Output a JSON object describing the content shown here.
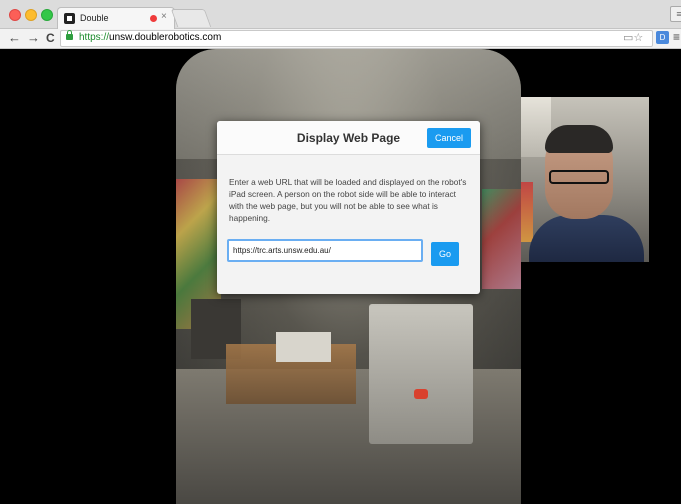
{
  "browser": {
    "tab_title": "Double",
    "tab_close": "×",
    "url_scheme": "https://",
    "url_host": "unsw.doublerobotics.com",
    "nav": {
      "back": "←",
      "forward": "→",
      "reload": "C"
    },
    "omnibox_icons": "▭☆",
    "menu": "≡"
  },
  "dialog": {
    "title": "Display Web Page",
    "cancel_label": "Cancel",
    "description": "Enter a web URL that will be loaded and displayed on the robot's iPad screen. A person on the robot side will be able to interact with the web page, but you will not be able to see what is happening.",
    "url_value": "https://trc.arts.unsw.edu.au/",
    "go_label": "Go"
  }
}
